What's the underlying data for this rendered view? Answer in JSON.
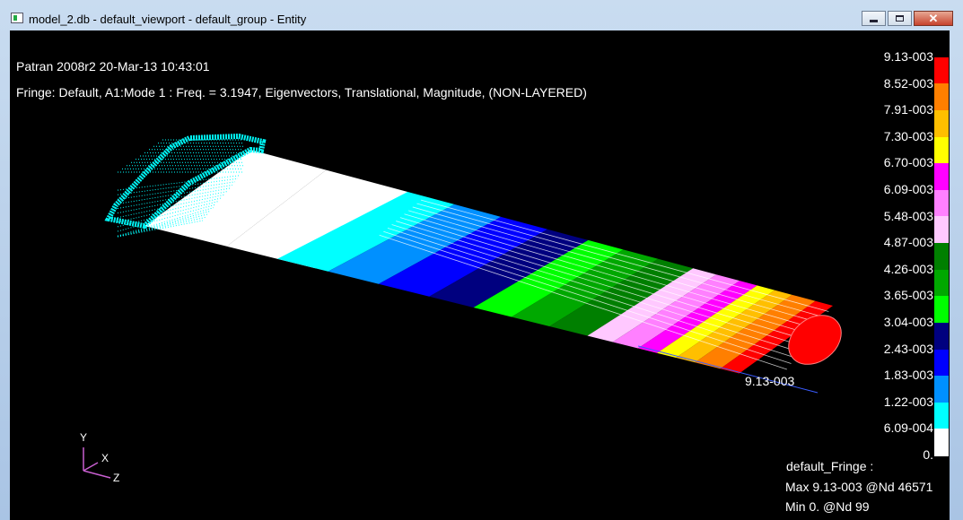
{
  "window": {
    "title": "model_2.db - default_viewport - default_group - Entity",
    "minimize_label": "",
    "maximize_label": "",
    "close_label": "✕"
  },
  "viewport": {
    "header_line1": "Patran 2008r2 20-Mar-13 10:43:01",
    "header_line2": "Fringe: Default, A1:Mode 1 : Freq. = 3.1947, Eigenvectors, Translational, Magnitude, (NON-LAYERED)",
    "node_value_label": "9.13-003",
    "summary": {
      "title": "default_Fringe :",
      "max": "Max 9.13-003 @Nd 46571",
      "min": "Min  0. @Nd 99"
    },
    "axis_labels": {
      "x": "X",
      "y": "Y",
      "z": "Z"
    }
  },
  "legend": {
    "labels": [
      "9.13-003",
      "8.52-003",
      "7.91-003",
      "7.30-003",
      "6.70-003",
      "6.09-003",
      "5.48-003",
      "4.87-003",
      "4.26-003",
      "3.65-003",
      "3.04-003",
      "2.43-003",
      "1.83-003",
      "1.22-003",
      "6.09-004",
      "0."
    ],
    "colors": [
      "#000000",
      "#ff0000",
      "#ff7f00",
      "#ffbf00",
      "#ffff00",
      "#ff00ff",
      "#ff80ff",
      "#ffc8ff",
      "#007f00",
      "#00a800",
      "#00ff00",
      "#00007f",
      "#0000ff",
      "#0090ff",
      "#00ffff",
      "#ffffff"
    ]
  }
}
